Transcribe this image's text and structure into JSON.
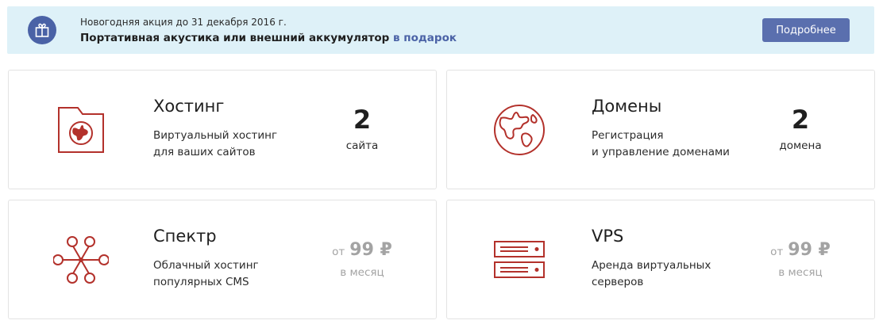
{
  "promo": {
    "line1": "Новогодняя акция до 31 декабря 2016 г.",
    "line2_text": "Портативная акустика или внешний аккумулятор",
    "line2_accent": "в подарок",
    "button_label": "Подробнее",
    "icon": "gift-icon"
  },
  "colors": {
    "accent": "#4a62a6",
    "icon_red": "#b3312b",
    "promo_bg": "#def1f8",
    "price_gray": "#a3a3a3"
  },
  "cards": [
    {
      "title": "Хостинг",
      "desc_line1": "Виртуальный хостинг",
      "desc_line2": "для ваших сайтов",
      "count": "2",
      "count_unit": "сайта",
      "icon": "folder-globe-icon"
    },
    {
      "title": "Домены",
      "desc_line1": "Регистрация",
      "desc_line2": "и управление доменами",
      "count": "2",
      "count_unit": "домена",
      "icon": "globe-icon"
    },
    {
      "title": "Спектр",
      "desc_line1": "Облачный хостинг",
      "desc_line2": "популярных CMS",
      "price_from": "от",
      "price_amount": "99 ₽",
      "price_period": "в месяц",
      "icon": "network-nodes-icon"
    },
    {
      "title": "VPS",
      "desc_line1": "Аренда виртуальных",
      "desc_line2": "серверов",
      "price_from": "от",
      "price_amount": "99 ₽",
      "price_period": "в месяц",
      "icon": "server-rack-icon"
    }
  ]
}
